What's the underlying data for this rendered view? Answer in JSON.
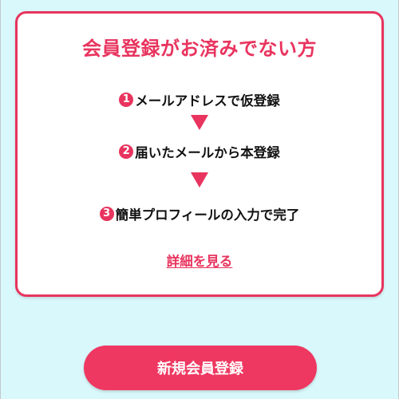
{
  "card": {
    "title": "会員登録がお済みでない方",
    "steps": [
      {
        "number": "1",
        "text": "メールアドレスで仮登録"
      },
      {
        "number": "2",
        "text": "届いたメールから本登録"
      },
      {
        "number": "3",
        "text": "簡単プロフィールの入力で完了"
      }
    ],
    "details_link": "詳細を見る"
  },
  "signup_button": {
    "label": "新規会員登録"
  },
  "colors": {
    "accent": "#e8345e",
    "background": "#d9f8fb",
    "card": "#ffffff",
    "text": "#111111"
  },
  "icons": {
    "step_arrow": "down-triangle-icon"
  }
}
